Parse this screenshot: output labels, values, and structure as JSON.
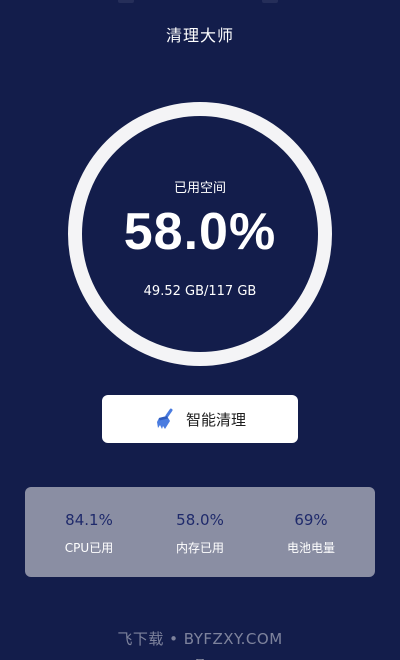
{
  "app": {
    "title": "清理大师"
  },
  "storage": {
    "label": "已用空间",
    "percent": "58.0%",
    "detail": "49.52 GB/117 GB",
    "used_fraction": 0.58
  },
  "clean_button": {
    "label": "智能清理",
    "icon": "broom-icon"
  },
  "stats": [
    {
      "value": "84.1%",
      "label": "CPU已用"
    },
    {
      "value": "58.0%",
      "label": "内存已用"
    },
    {
      "value": "69%",
      "label": "电池电量"
    }
  ],
  "watermark": "飞下载 • BYFZXY.COM",
  "bottom_nav": {
    "icons": [
      "home-icon",
      "toolbox-icon",
      "profile-icon"
    ]
  },
  "colors": {
    "background": "#131d4b",
    "ring": "#f4f4f6",
    "card": "#8a8ea3",
    "stat_value": "#1f2a6b",
    "button": "#ffffff",
    "accent": "#4a7ce0"
  }
}
